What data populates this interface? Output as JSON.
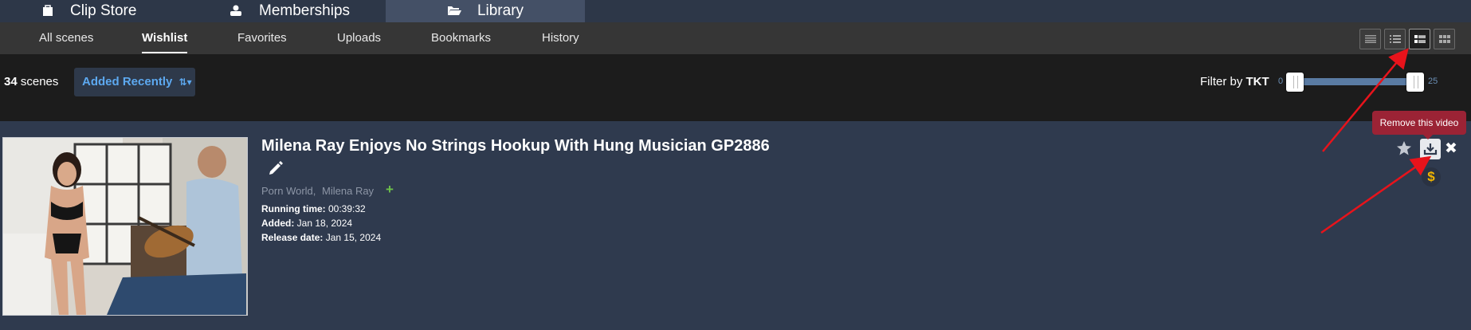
{
  "topnav": {
    "tabs": [
      {
        "label": "Clip Store",
        "icon": "shopping-bag-icon"
      },
      {
        "label": "Memberships",
        "icon": "users-icon"
      },
      {
        "label": "Library",
        "icon": "folder-open-icon"
      }
    ]
  },
  "subnav": {
    "items": [
      "All scenes",
      "Wishlist",
      "Favorites",
      "Uploads",
      "Bookmarks",
      "History"
    ],
    "active": "Wishlist",
    "view_modes": [
      "compact-list-icon",
      "list-icon",
      "detail-list-icon",
      "grid-icon"
    ],
    "active_view": "detail-list-icon"
  },
  "filterbar": {
    "count": "34",
    "count_label": "scenes",
    "sort_label": "Added Recently",
    "filter_prefix": "Filter by",
    "filter_unit": "TKT",
    "slider_min": "0",
    "slider_max": "25",
    "slider_range": [
      0,
      25
    ]
  },
  "scene": {
    "title": "Milena Ray Enjoys No Strings Hookup With Hung Musician GP2886",
    "studio": "Porn World,",
    "performer": "Milena Ray",
    "plus_label": "+",
    "running_label": "Running time:",
    "running_value": "00:39:32",
    "added_label": "Added:",
    "added_value": "Jan 18, 2024",
    "release_label": "Release date:",
    "release_value": "Jan 15, 2024",
    "dollar": "$",
    "tooltip": "Remove this video"
  },
  "colors": {
    "accent_blue": "#5da9f0",
    "tooltip_red": "#9b2335",
    "plus_green": "#6cc04a",
    "dollar_gold": "#f0b400",
    "annotation_arrow": "#e8131b"
  }
}
